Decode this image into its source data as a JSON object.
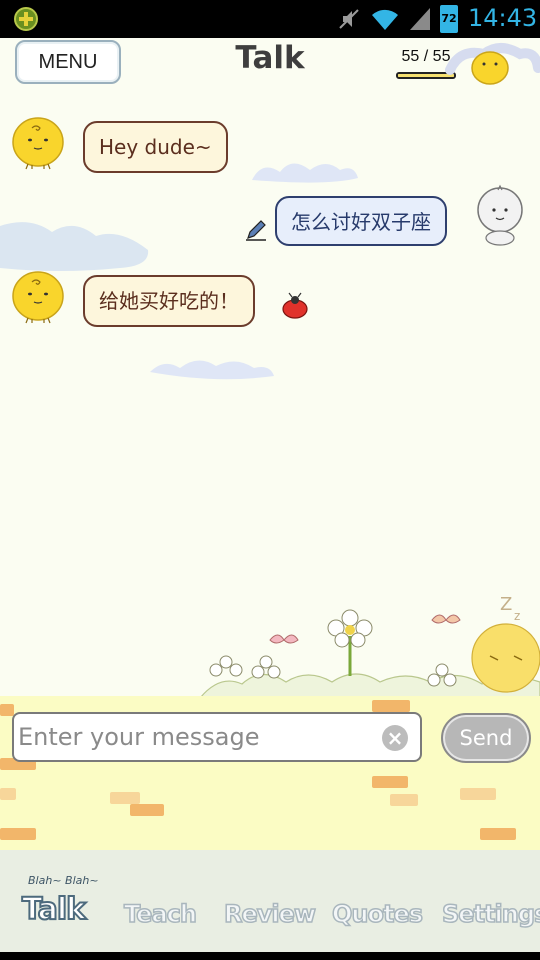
{
  "status_bar": {
    "time": "14:43",
    "battery_level": "72",
    "icons": [
      "app-notification-icon",
      "mute-icon",
      "wifi-icon",
      "signal-icon",
      "battery-icon"
    ]
  },
  "header": {
    "menu_label": "MENU",
    "title": "Talk",
    "counter": "55 / 55",
    "counter_fraction": 1.0
  },
  "messages": [
    {
      "sender": "bot",
      "text": "Hey dude~"
    },
    {
      "sender": "user",
      "text": "怎么讨好双子座"
    },
    {
      "sender": "bot",
      "text": "给她买好吃的！"
    }
  ],
  "input": {
    "placeholder": "Enter your message",
    "value": "",
    "send_label": "Send"
  },
  "tabs": {
    "caption": "Blah~ Blah~",
    "items": [
      {
        "label": "Talk",
        "active": true
      },
      {
        "label": "Teach",
        "active": false
      },
      {
        "label": "Review",
        "active": false
      },
      {
        "label": "Quotes",
        "active": false
      },
      {
        "label": "Settings",
        "active": false
      }
    ]
  },
  "colors": {
    "background": "#fbfdf2",
    "status_accent": "#33b5e5",
    "bot_bubble_border": "#6b3c2c",
    "user_bubble_border": "#2e3f6e",
    "ground": "#fbfcc4"
  }
}
